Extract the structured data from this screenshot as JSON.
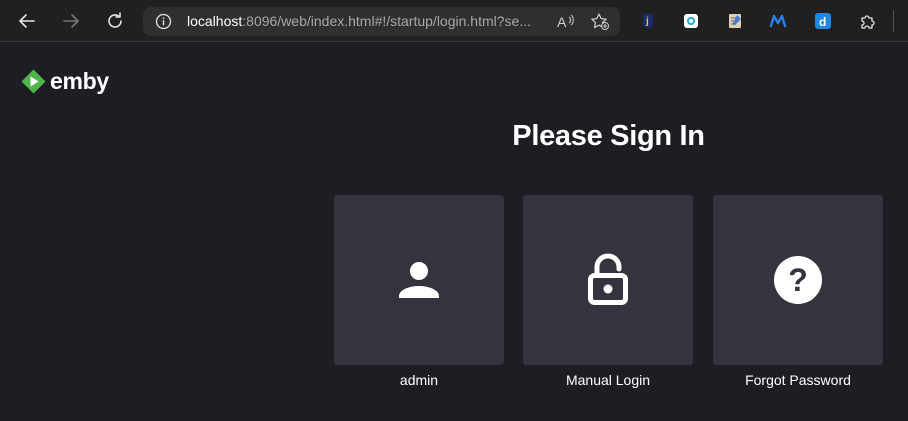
{
  "browser": {
    "url_host": "localhost",
    "url_rest": ":8096/web/index.html#!/startup/login.html?se...",
    "nav": {
      "back_icon": "arrow-left-icon",
      "forward_icon": "arrow-right-icon",
      "refresh_icon": "refresh-icon"
    },
    "extensions": [
      {
        "name": "extension-j-icon"
      },
      {
        "name": "extension-camera-icon"
      },
      {
        "name": "extension-notepad-icon"
      },
      {
        "name": "extension-m-icon"
      },
      {
        "name": "extension-d-icon"
      },
      {
        "name": "extensions-puzzle-icon"
      }
    ]
  },
  "app": {
    "logo_text": "emby",
    "brand_color": "#52b54b"
  },
  "login": {
    "title": "Please Sign In",
    "options": [
      {
        "label": "admin",
        "icon": "user-icon"
      },
      {
        "label": "Manual Login",
        "icon": "unlock-icon"
      },
      {
        "label": "Forgot Password",
        "icon": "help-circle-icon"
      }
    ]
  },
  "colors": {
    "background": "#1e1d24",
    "card": "#35343e",
    "text": "#ffffff"
  }
}
